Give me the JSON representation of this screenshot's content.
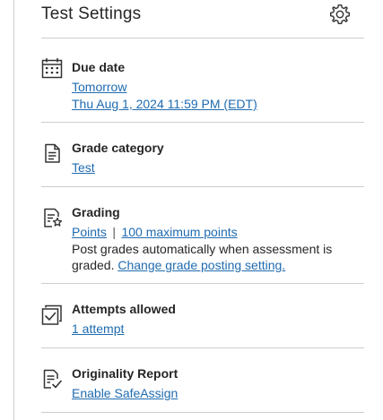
{
  "panel": {
    "title": "Test Settings"
  },
  "due_date": {
    "label": "Due date",
    "relative": "Tomorrow",
    "full": "Thu Aug 1, 2024 11:59 PM (EDT)"
  },
  "grade_category": {
    "label": "Grade category",
    "value": "Test"
  },
  "grading": {
    "label": "Grading",
    "type": "Points",
    "separator": "|",
    "max_points": "100 maximum points",
    "posting_text": "Post grades automatically when assessment is graded.",
    "posting_link": "Change grade posting setting."
  },
  "attempts": {
    "label": "Attempts allowed",
    "value": "1 attempt"
  },
  "originality": {
    "label": "Originality Report",
    "action": "Enable SafeAssign"
  },
  "colors": {
    "link": "#1f6bb0",
    "text": "#262626",
    "divider": "#cdcdcd"
  },
  "icons": {
    "settings": "gear-icon",
    "due_date": "calendar-icon",
    "grade_category": "document-icon",
    "grading": "grading-star-icon",
    "attempts": "checkbox-stack-icon",
    "originality": "document-check-icon"
  }
}
